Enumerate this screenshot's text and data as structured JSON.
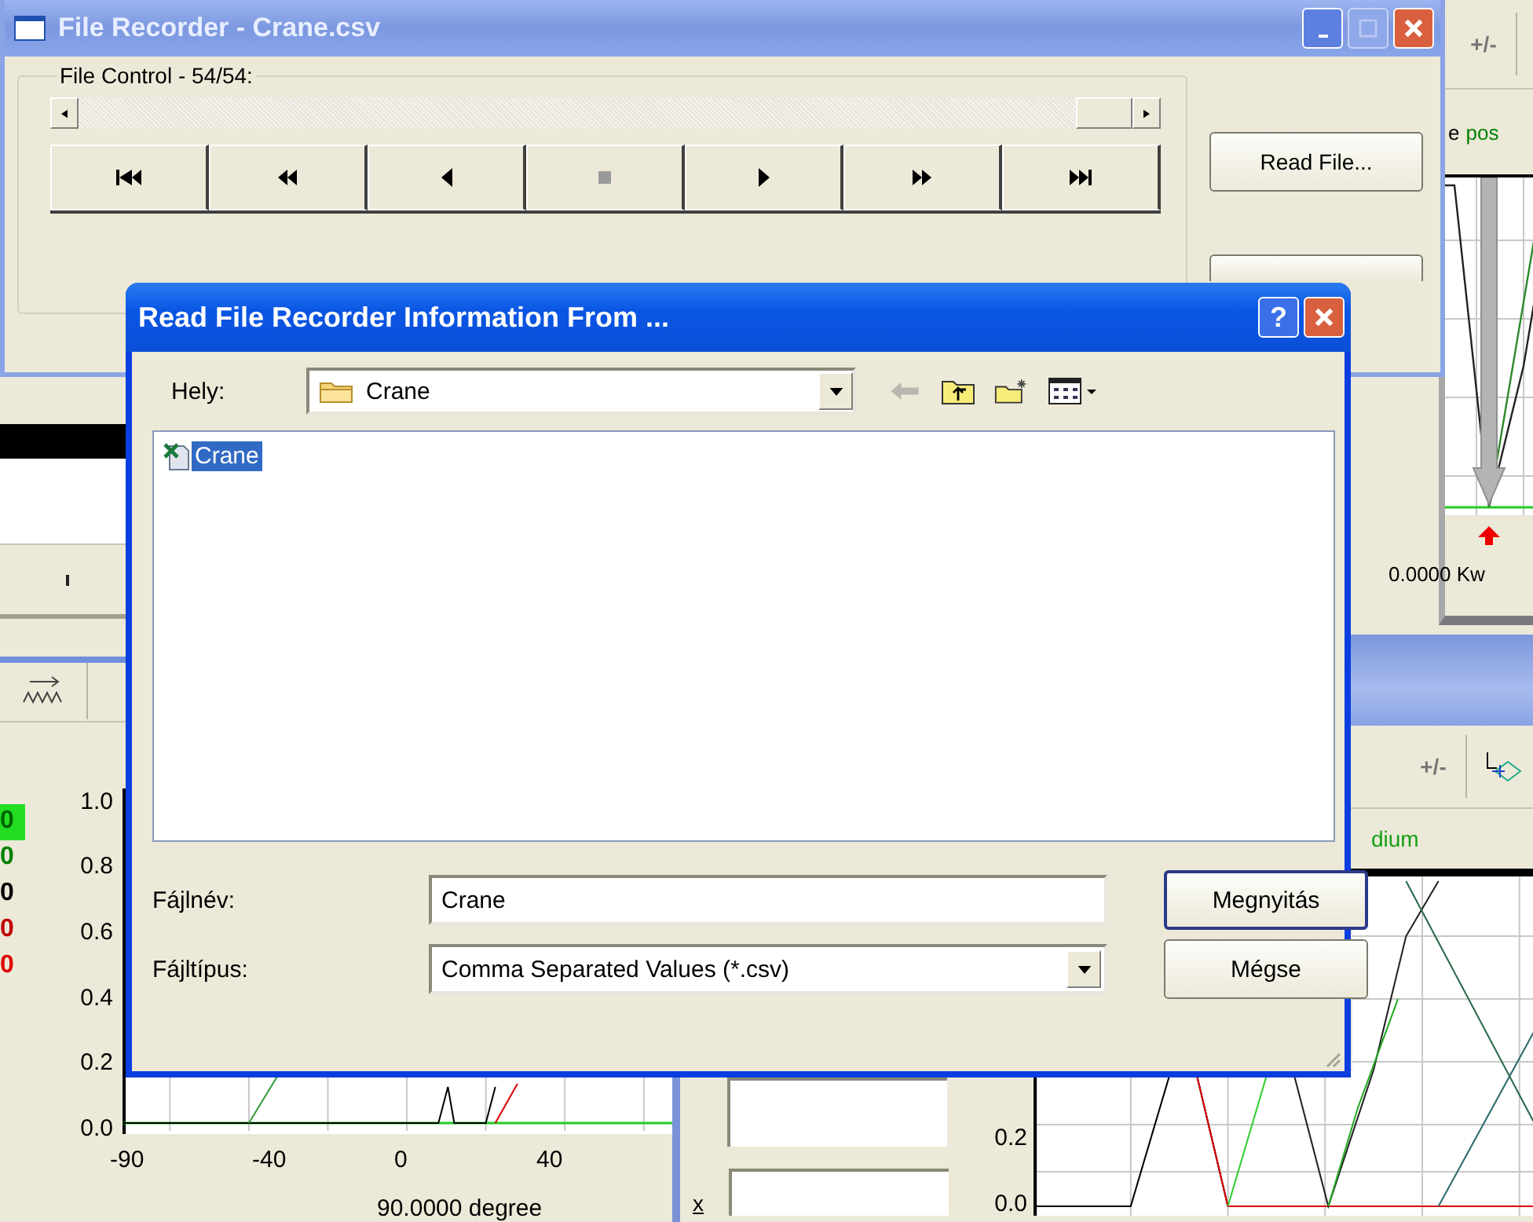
{
  "recorder_window": {
    "title": "File Recorder - Crane.csv",
    "group_label": "File Control - 54/54:",
    "transport": [
      {
        "kind": "first",
        "disabled": false
      },
      {
        "kind": "rewind",
        "disabled": false
      },
      {
        "kind": "back",
        "disabled": false
      },
      {
        "kind": "stop",
        "disabled": true
      },
      {
        "kind": "play",
        "disabled": false
      },
      {
        "kind": "forward",
        "disabled": false
      },
      {
        "kind": "last",
        "disabled": false
      }
    ],
    "read_button": "Read File..."
  },
  "top_right_window": {
    "toolbar_label": "+/-",
    "legend": [
      {
        "text": "e",
        "color": "#000000"
      },
      {
        "text": "pos",
        "color": "#008000"
      }
    ],
    "reading": "0.0000 Kw"
  },
  "bottom_right_window": {
    "toolbar_label": "+/-",
    "legend": "dium",
    "y_ticks": [
      "0.2",
      "0.0"
    ],
    "axis_label": "x"
  },
  "bottom_left_window": {
    "values": [
      {
        "text": "0",
        "color": "#006400",
        "highlighted": true
      },
      {
        "text": "0",
        "color": "#008000",
        "highlighted": false
      },
      {
        "text": "0",
        "color": "#000000",
        "highlighted": false
      },
      {
        "text": "0",
        "color": "#c00000",
        "highlighted": false
      },
      {
        "text": "0",
        "color": "#e00000",
        "highlighted": false
      }
    ],
    "y_ticks": [
      "1.0",
      "0.8",
      "0.6",
      "0.4",
      "0.2",
      "0.0"
    ],
    "x_ticks": [
      "-90",
      "-40",
      "0",
      "40"
    ],
    "reading": "90.0000 degree"
  },
  "dialog": {
    "title": "Read File Recorder Information From ...",
    "help_button": "?",
    "location_label": "Hely:",
    "location": "Crane",
    "files": [
      {
        "name": "Crane",
        "selected": true
      }
    ],
    "filename_label": "Fájlnév:",
    "filename": "Crane",
    "filetype_label": "Fájltípus:",
    "filetype": "Comma Separated Values (*.csv)",
    "buttons": [
      "Megnyitás",
      "Mégse"
    ]
  }
}
